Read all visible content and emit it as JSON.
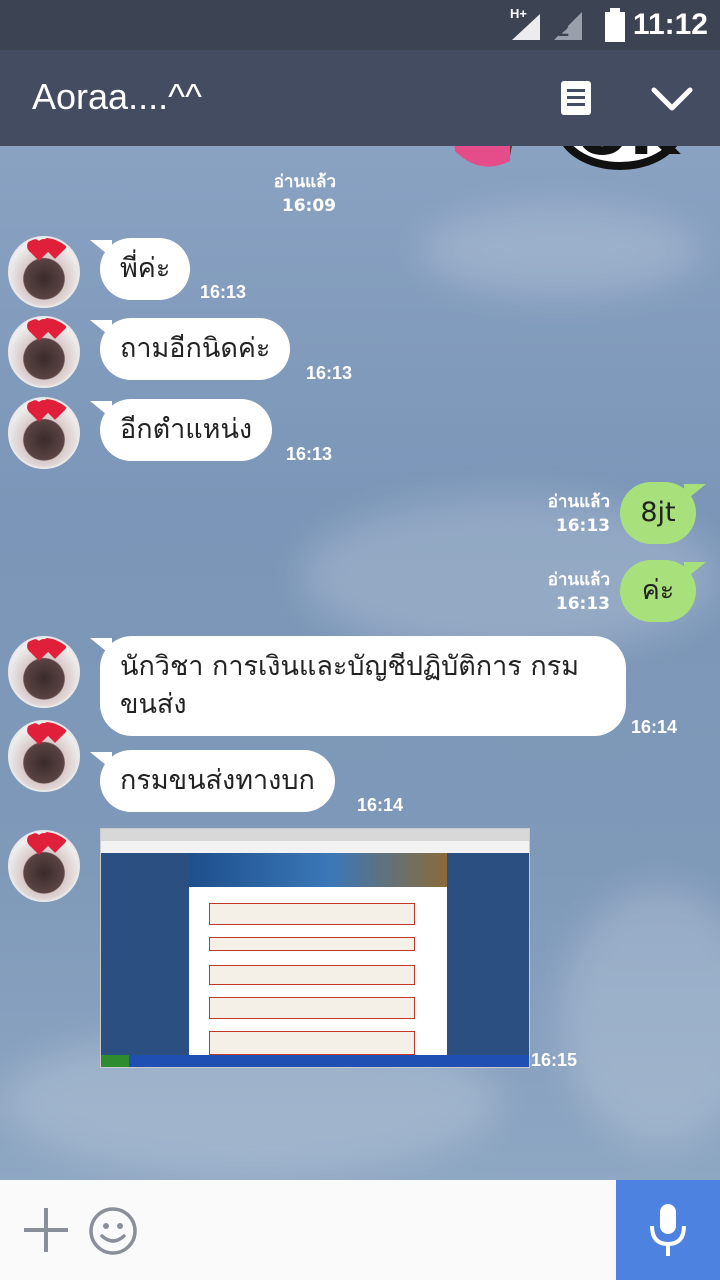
{
  "status_bar": {
    "time": "11:12",
    "network_type": "H+",
    "sim_slot": "2"
  },
  "header": {
    "title": "Aoraa....^^",
    "notes_icon": "notes-icon",
    "collapse_icon": "chevron-down-icon"
  },
  "chat": {
    "sticker": {
      "text": "OK",
      "read_label": "อ่านแล้ว",
      "time": "16:09"
    },
    "messages": [
      {
        "dir": "in",
        "text": "พี่ค่ะ",
        "time": "16:13"
      },
      {
        "dir": "in",
        "text": "ถามอีกนิดค่ะ",
        "time": "16:13"
      },
      {
        "dir": "in",
        "text": "อีกตำแหน่ง",
        "time": "16:13"
      },
      {
        "dir": "out",
        "text": "8jt",
        "read_label": "อ่านแล้ว",
        "time": "16:13"
      },
      {
        "dir": "out",
        "text": "ค่ะ",
        "read_label": "อ่านแล้ว",
        "time": "16:13"
      },
      {
        "dir": "in",
        "text_line1": "นักวิชา การเงินและบัญชีปฏิบัติการ กรม",
        "text_line2": "ขนส่ง",
        "time": "16:14"
      },
      {
        "dir": "in",
        "text": "กรมขนส่งทางบก",
        "time": "16:14"
      },
      {
        "dir": "in",
        "type": "image",
        "time": "16:15"
      }
    ]
  },
  "input_bar": {
    "plus_icon": "plus-icon",
    "emoji_icon": "smile-icon",
    "mic_icon": "mic-icon"
  },
  "colors": {
    "status_bar": "#3c4353",
    "header": "#434c61",
    "incoming_bubble": "#ffffff",
    "outgoing_bubble": "#a8e07b",
    "mic_button": "#4e82e0"
  }
}
